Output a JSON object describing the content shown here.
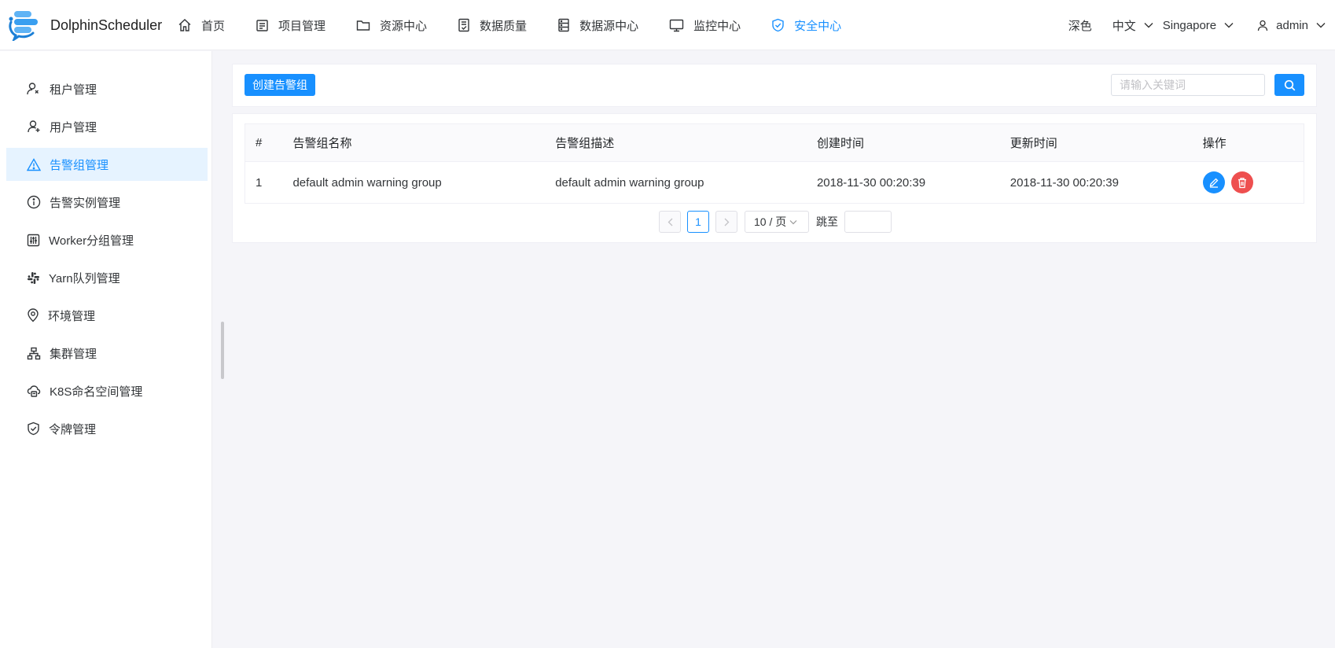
{
  "app": {
    "name": "DolphinScheduler",
    "accent_color": "#1890ff",
    "danger_color": "#ee4f4f"
  },
  "nav": {
    "items": [
      {
        "label": "首页",
        "icon": "home-icon"
      },
      {
        "label": "项目管理",
        "icon": "project-icon"
      },
      {
        "label": "资源中心",
        "icon": "folder-icon"
      },
      {
        "label": "数据质量",
        "icon": "data-quality-icon"
      },
      {
        "label": "数据源中心",
        "icon": "datasource-icon"
      },
      {
        "label": "监控中心",
        "icon": "monitor-icon"
      },
      {
        "label": "安全中心",
        "icon": "shield-check-icon",
        "active": true
      }
    ]
  },
  "header_right": {
    "theme": "深色",
    "language": "中文",
    "timezone": "Singapore",
    "user": "admin"
  },
  "sidebar": {
    "items": [
      {
        "label": "租户管理",
        "icon": "tenant-icon"
      },
      {
        "label": "用户管理",
        "icon": "user-add-icon"
      },
      {
        "label": "告警组管理",
        "icon": "warning-triangle-icon",
        "active": true
      },
      {
        "label": "告警实例管理",
        "icon": "info-circle-icon"
      },
      {
        "label": "Worker分组管理",
        "icon": "sliders-icon"
      },
      {
        "label": "Yarn队列管理",
        "icon": "slack-icon"
      },
      {
        "label": "环境管理",
        "icon": "location-pin-icon"
      },
      {
        "label": "集群管理",
        "icon": "cluster-icon"
      },
      {
        "label": "K8S命名空间管理",
        "icon": "cloud-server-icon"
      },
      {
        "label": "令牌管理",
        "icon": "shield-check-icon"
      }
    ]
  },
  "toolbar": {
    "create_label": "创建告警组",
    "search_placeholder": "请输入关键词"
  },
  "table": {
    "columns": [
      "#",
      "告警组名称",
      "告警组描述",
      "创建时间",
      "更新时间",
      "操作"
    ],
    "rows": [
      {
        "index": "1",
        "name": "default admin warning group",
        "description": "default admin warning group",
        "created": "2018-11-30 00:20:39",
        "updated": "2018-11-30 00:20:39"
      }
    ]
  },
  "pagination": {
    "current_page": "1",
    "page_size": "10 / 页",
    "jump_label": "跳至"
  }
}
